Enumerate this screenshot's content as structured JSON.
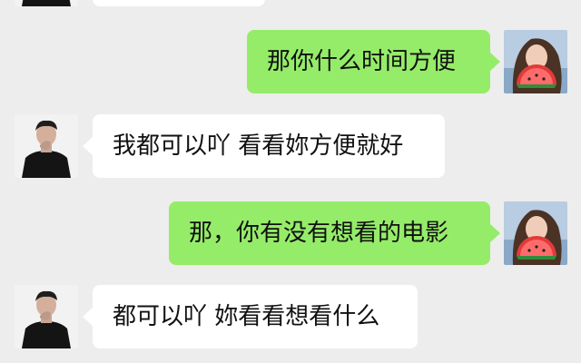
{
  "colors": {
    "background": "#ededed",
    "incoming_bubble": "#ffffff",
    "outgoing_bubble": "#95ec69",
    "text": "#111111"
  },
  "icons": {
    "contact_avatar": "contact-avatar-icon",
    "self_avatar": "self-avatar-icon"
  },
  "messages": [
    {
      "sender": "contact",
      "text": ""
    },
    {
      "sender": "self",
      "text": "那你什么时间方便"
    },
    {
      "sender": "contact",
      "text": "我都可以吖 看看妳方便就好"
    },
    {
      "sender": "self",
      "text": "那，你有没有想看的电影"
    },
    {
      "sender": "contact",
      "text": "都可以吖 妳看看想看什么"
    }
  ]
}
